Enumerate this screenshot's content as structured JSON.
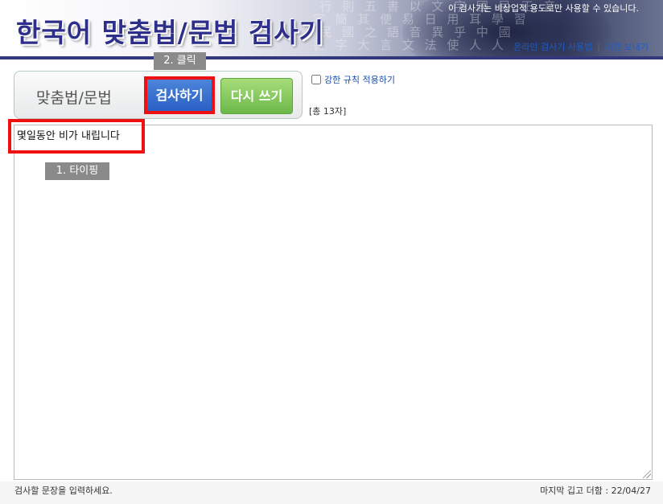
{
  "header": {
    "logo_text": "한국어 맞춤법/문법 검사기",
    "notice": "이 검사기는 비상업적 용도로만 사용할 수 있습니다.",
    "link_usage": "온라인 검사기 사용법",
    "link_separator": "|",
    "link_feedback": "의견 보내기"
  },
  "toolbar": {
    "title": "맞춤법/문법",
    "check_button": "검사하기",
    "rewrite_button": "다시 쓰기",
    "strict_label": "강한 규칙 적용하기",
    "strict_checked": false,
    "char_count": "[총 13자]"
  },
  "editor": {
    "text": "몇일동안 비가 내립니다"
  },
  "annotations": {
    "step1_label": "1. 타이핑",
    "step2_label": "2. 클릭",
    "color": "#ee1111"
  },
  "footer": {
    "help_text": "검사할 문장을 입력하세요.",
    "last_update": "마지막 깁고 더함 : 22/04/27"
  },
  "colors": {
    "header_bar": "#33397a",
    "logo": "#2e2f8a",
    "check_button": "#2a5fc4",
    "rewrite_button": "#6db84a",
    "link": "#1d5cc7"
  }
}
